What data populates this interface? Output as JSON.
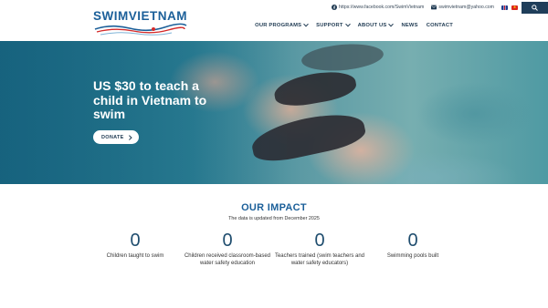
{
  "logo": {
    "part1": "SWIM",
    "part2": "VIETNAM"
  },
  "topbar": {
    "facebook": "https://www.facebook.com/SwimVietnam",
    "email": "swimvietnam@yahoo.com"
  },
  "nav": {
    "items": [
      {
        "label": "OUR PROGRAMS"
      },
      {
        "label": "SUPPORT"
      },
      {
        "label": "ABOUT US"
      },
      {
        "label": "NEWS"
      },
      {
        "label": "CONTACT"
      }
    ]
  },
  "hero": {
    "title": "US $30 to teach a child in Vietnam to swim",
    "donate_label": "DONATE"
  },
  "impact": {
    "title": "OUR IMPACT",
    "subtitle": "The data is updated from December 2025",
    "stats": [
      {
        "value": "0",
        "label": "Children taught to swim"
      },
      {
        "value": "0",
        "label": "Children received classroom-based water safety education"
      },
      {
        "value": "0",
        "label": "Teachers trained (swim teachers and water safety educators)"
      },
      {
        "value": "0",
        "label": "Swimming pools built"
      }
    ]
  },
  "colors": {
    "brand": "#1b5f99",
    "dark": "#1f3e5a",
    "accent_red": "#d42a2a"
  }
}
